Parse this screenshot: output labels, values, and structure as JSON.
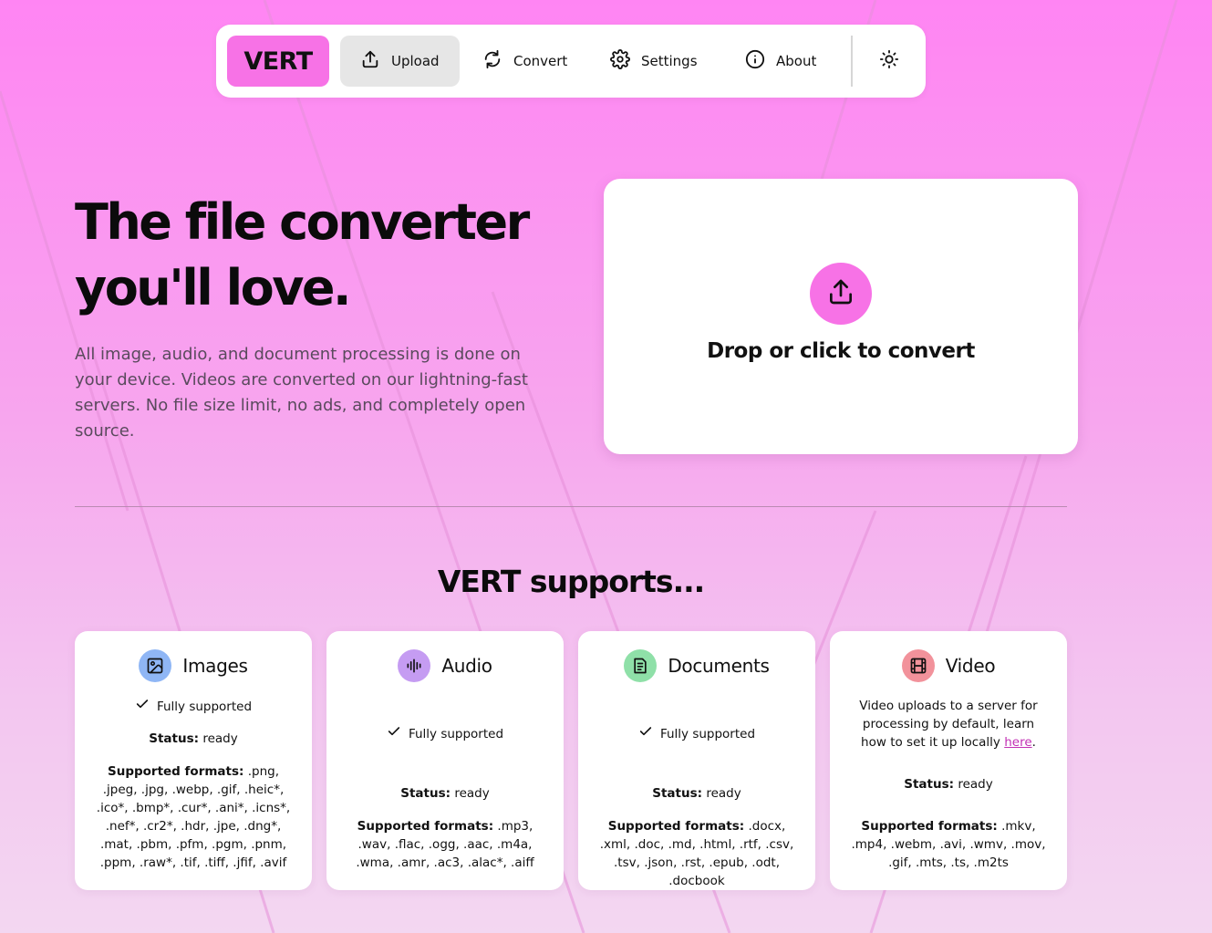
{
  "nav": {
    "logo": "VERT",
    "items": [
      {
        "label": "Upload",
        "icon": "upload-icon"
      },
      {
        "label": "Convert",
        "icon": "refresh-icon"
      },
      {
        "label": "Settings",
        "icon": "gear-icon"
      },
      {
        "label": "About",
        "icon": "info-icon"
      }
    ],
    "active": "Upload",
    "theme_toggle_icon": "sun-icon"
  },
  "hero": {
    "title_line1": "The file converter",
    "title_line2": "you'll love.",
    "description": "All image, audio, and document processing is done on your device. Videos are converted on our lightning-fast servers. No file size limit, no ads, and completely open source."
  },
  "dropzone": {
    "icon": "upload-icon",
    "label": "Drop or click to convert"
  },
  "supports": {
    "title": "VERT supports...",
    "status_label": "Status:",
    "formats_label": "Supported formats:",
    "cards": [
      {
        "title": "Images",
        "icon": "image-icon",
        "icon_color": "#8fb6f5",
        "support": "Fully supported",
        "status": "ready",
        "formats": ".png, .jpeg, .jpg, .webp, .gif, .heic*, .ico*, .bmp*, .cur*, .ani*, .icns*, .nef*, .cr2*, .hdr, .jpe, .dng*, .mat, .pbm, .pfm, .pgm, .pnm, .ppm, .raw*, .tif, .tiff, .jfif, .avif"
      },
      {
        "title": "Audio",
        "icon": "audio-waveform-icon",
        "icon_color": "#c59cf2",
        "support": "Fully supported",
        "status": "ready",
        "formats": ".mp3, .wav, .flac, .ogg, .aac, .m4a, .wma, .amr, .ac3, .alac*, .aiff"
      },
      {
        "title": "Documents",
        "icon": "document-icon",
        "icon_color": "#8fe0a8",
        "support": "Fully supported",
        "status": "ready",
        "formats": ".docx, .xml, .doc, .md, .html, .rtf, .csv, .tsv, .json, .rst, .epub, .odt, .docbook"
      },
      {
        "title": "Video",
        "icon": "film-icon",
        "icon_color": "#f2929b",
        "note": "Video uploads to a server for processing by default, learn how to set it up locally",
        "note_link": "here",
        "status": "ready",
        "formats": ".mkv, .mp4, .webm, .avi, .wmv, .mov, .gif, .mts, .ts, .m2ts"
      }
    ]
  },
  "colors": {
    "accent": "#f772e6",
    "link": "#c230b4"
  }
}
